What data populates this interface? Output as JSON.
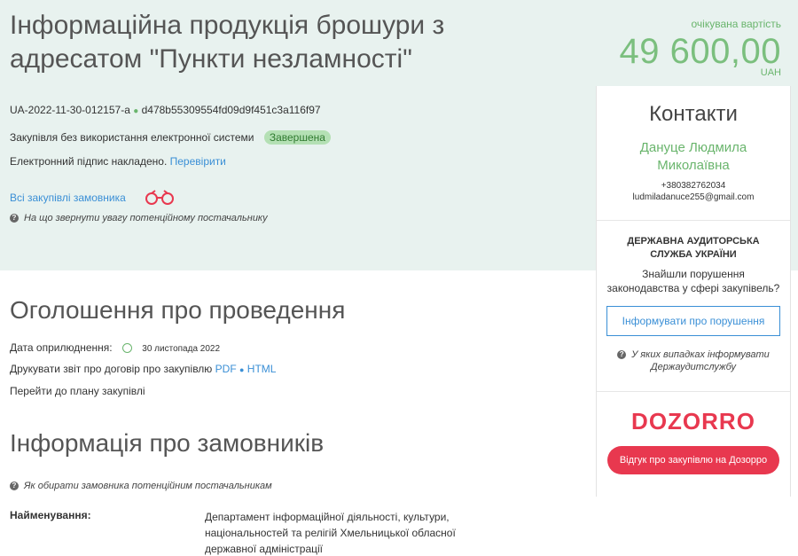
{
  "header": {
    "title": "Інформаційна продукція брошури з адресатом \"Пункти незламності\"",
    "price_label": "очікувана вартість",
    "price": "49 600,00",
    "currency": "UAH"
  },
  "tender": {
    "id": "UA-2022-11-30-012157-a",
    "hash": "d478b55309554fd09d9f451c3a116f97",
    "procurement_type": "Закупівля без використання електронної системи",
    "status": "Завершена",
    "signature_text": "Електронний підпис накладено.",
    "verify_link": "Перевірити",
    "all_purchases_link": "Всі закупівлі замовника",
    "supplier_hint": "На що звернути увагу потенційному постачальнику"
  },
  "contacts": {
    "title": "Контакти",
    "name": "Дануце Людмила Миколаївна",
    "phone": "+380382762034",
    "email": "ludmiladanuce255@gmail.com"
  },
  "audit": {
    "heading": "ДЕРЖАВНА АУДИТОРСЬКА СЛУЖБА УКРАЇНИ",
    "text": "Знайшли порушення законодавства у сфері закупівель?",
    "button": "Інформувати про порушення",
    "hint": "У яких випадках інформувати Держаудитслужбу"
  },
  "dozorro": {
    "logo": "DOZORRO",
    "button": "Відгук про закупівлю на Дозорро"
  },
  "announcement": {
    "title": "Оголошення про проведення",
    "date_label": "Дата оприлюднення:",
    "date": "30 листопада 2022",
    "print_label": "Друкувати звіт про договір про закупівлю",
    "pdf": "PDF",
    "html": "HTML",
    "plan_link": "Перейти до плану закупівлі"
  },
  "customers": {
    "title": "Інформація про замовників",
    "hint": "Як обирати замовника потенційним постачальникам",
    "name_label": "Найменування:",
    "name_value": "Департамент інформаційної діяльності, культури, національностей та релігій Хмельницької обласної державної адміністрації"
  }
}
